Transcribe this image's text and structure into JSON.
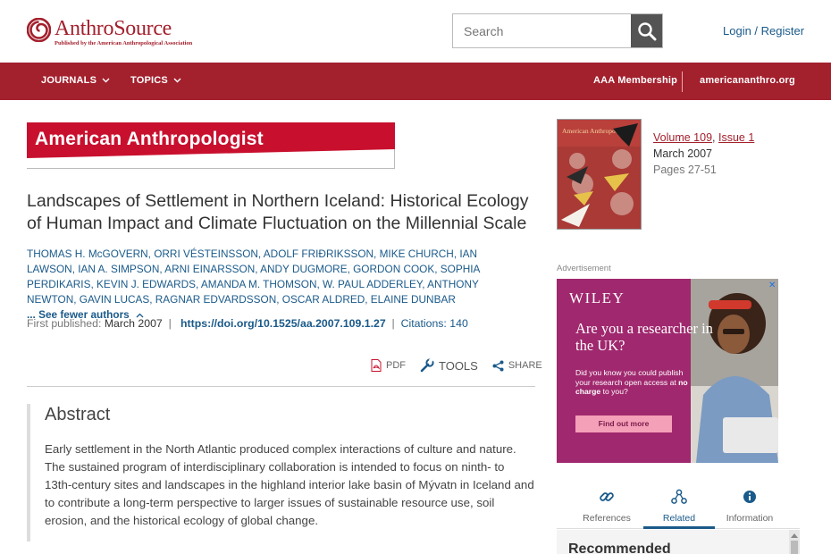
{
  "header": {
    "logo_title": "AnthroSource",
    "logo_subtitle": "Published by the American Anthropological Association",
    "search_placeholder": "Search",
    "login_label": "Login / Register"
  },
  "nav": {
    "journals_label": "JOURNALS",
    "topics_label": "TOPICS",
    "membership_label": "AAA Membership",
    "site_label": "americananthro.org"
  },
  "article": {
    "journal_name": "American Anthropologist",
    "title": "Landscapes of Settlement in Northern Iceland: Historical Ecology of Human Impact and Climate Fluctuation on the Millennial Scale",
    "authors": "THOMAS H. McGOVERN, ORRI VÉSTEINSSON, ADOLF FRIÐRIKSSON, MIKE CHURCH, IAN LAWSON, IAN A. SIMPSON, ARNI EINARSSON, ANDY DUGMORE, GORDON COOK, SOPHIA PERDIKARIS, KEVIN J. EDWARDS, AMANDA M. THOMSON, W. PAUL ADDERLEY, ANTHONY NEWTON, GAVIN LUCAS, RAGNAR EDVARDSSON, OSCAR ALDRED, ELAINE DUNBAR",
    "see_fewer_label": "... See fewer authors",
    "first_published_label": "First published:",
    "first_published_date": "March 2007",
    "doi": "https://doi.org/10.1525/aa.2007.109.1.27",
    "citations": "Citations: 140"
  },
  "tools": {
    "pdf_label": "PDF",
    "tools_label": "TOOLS",
    "share_label": "SHARE"
  },
  "abstract": {
    "heading": "Abstract",
    "text": "Early settlement in the North Atlantic produced complex interactions of culture and nature. The sustained program of interdisciplinary collaboration is intended to focus on ninth- to 13th-century sites and landscapes in the highland interior lake basin of Mývatn in Iceland and to contribute a long-term perspective to larger issues of sustainable resource use, soil erosion, and the historical ecology of global change."
  },
  "issue": {
    "cover_title": "American Anthropologist",
    "volume": "Volume 109",
    "issue": "Issue 1",
    "separator": ", ",
    "date": "March 2007",
    "pages": "Pages 27-51"
  },
  "ad": {
    "label": "Advertisement",
    "brand": "WILEY",
    "headline": "Are you a researcher in the UK?",
    "body_1": "Did you know you could publish your research open access at ",
    "body_bold": "no charge",
    "body_2": " to you?",
    "cta": "Find out more",
    "close": "✕"
  },
  "tabs": [
    {
      "label": "References",
      "icon": "link-icon"
    },
    {
      "label": "Related",
      "icon": "network-icon"
    },
    {
      "label": "Information",
      "icon": "info-icon"
    }
  ],
  "recommended": {
    "title": "Recommended"
  },
  "colors": {
    "brand_red": "#a3202d",
    "journal_red": "#c8102e",
    "link_blue": "#1a5a8a",
    "ad_purple": "#a0286e"
  }
}
